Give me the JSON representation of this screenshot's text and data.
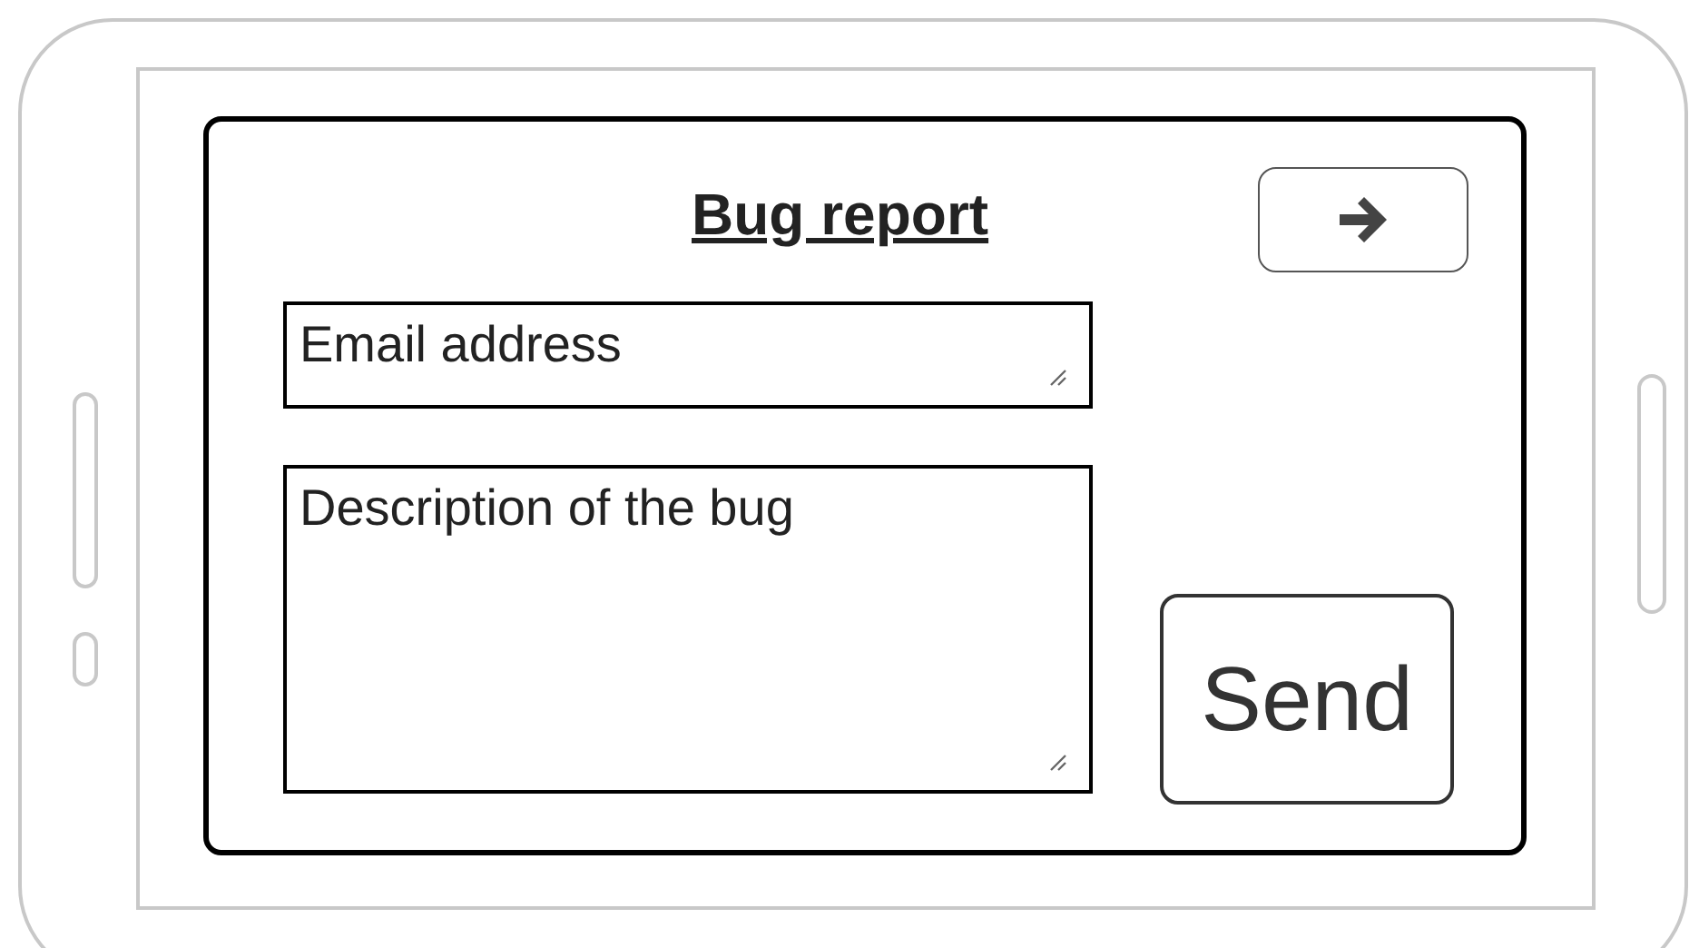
{
  "title": "Bug report",
  "fields": [
    {
      "kind": "line",
      "placeholder": "Email address"
    },
    {
      "kind": "area",
      "placeholder": "Description of the bug"
    }
  ],
  "send_button": {
    "label": "Send"
  }
}
